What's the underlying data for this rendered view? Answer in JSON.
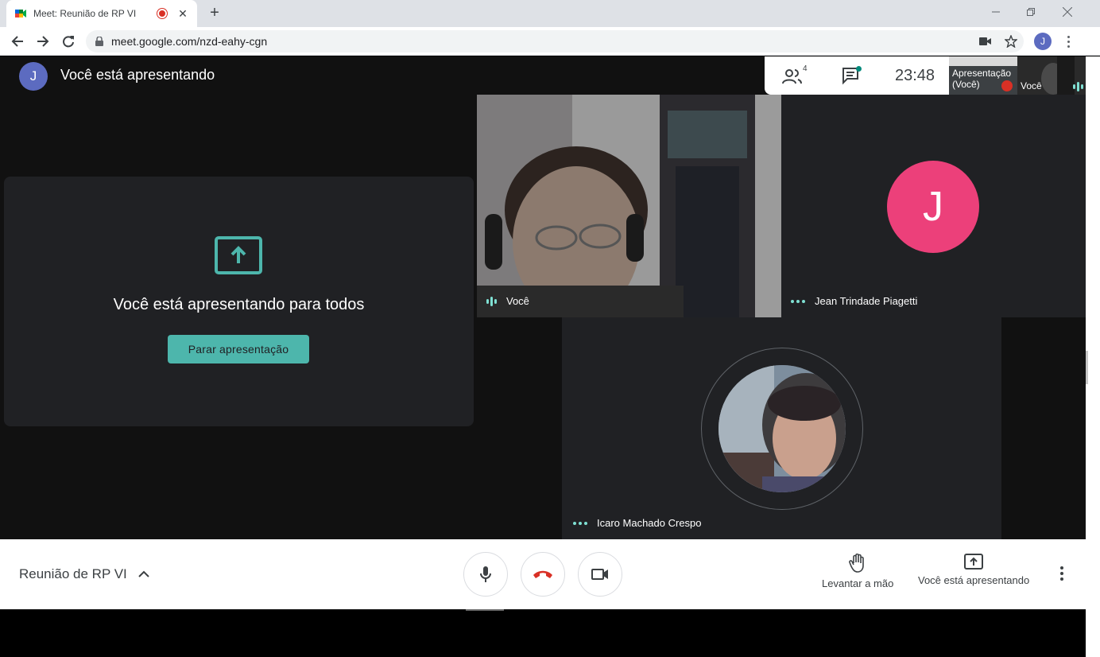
{
  "browser": {
    "tab_title": "Meet: Reunião de RP VI",
    "url": "meet.google.com/nzd-eahy-cgn",
    "profile_initial": "J"
  },
  "meet": {
    "user_initial": "J",
    "presenting_title": "Você está apresentando",
    "people_count": "4",
    "clock": "23:48",
    "thumb_presentation_label": "Apresentação (Você)",
    "thumb_self_label": "Você",
    "present_heading": "Você está apresentando para todos",
    "stop_button": "Parar apresentação",
    "tiles": {
      "self_name": "Você",
      "jean_name": "Jean Trindade Piagetti",
      "jean_initial": "J",
      "icaro_name": "Icaro Machado Crespo"
    }
  },
  "bottom": {
    "meeting_name": "Reunião de RP VI",
    "raise_hand": "Levantar a mão",
    "presenting": "Você está apresentando"
  },
  "colors": {
    "accent": "#4db6ac",
    "hangup": "#d93025",
    "jean_avatar": "#ec407a",
    "user_avatar": "#5c6bc0"
  }
}
